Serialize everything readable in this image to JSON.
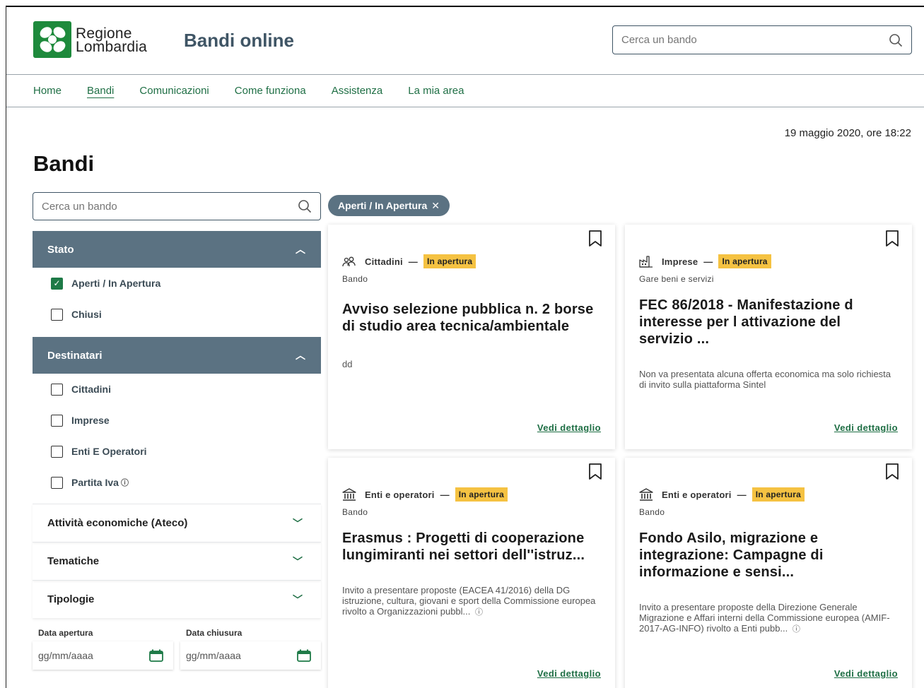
{
  "header": {
    "brand_line1": "Regione",
    "brand_line2": "Lombardia",
    "site_title": "Bandi online",
    "search_placeholder": "Cerca un bando"
  },
  "nav": [
    "Home",
    "Bandi",
    "Comunicazioni",
    "Come funziona",
    "Assistenza",
    "La mia area"
  ],
  "nav_active": "Bandi",
  "timestamp": "19 maggio 2020, ore 18:22",
  "page_title": "Bandi",
  "sidebar": {
    "search_placeholder": "Cerca un bando",
    "stato": {
      "title": "Stato",
      "options": [
        {
          "label": "Aperti / In Apertura",
          "checked": true
        },
        {
          "label": "Chiusi",
          "checked": false
        }
      ]
    },
    "destinatari": {
      "title": "Destinatari",
      "options": [
        {
          "label": "Cittadini",
          "checked": false
        },
        {
          "label": "Imprese",
          "checked": false
        },
        {
          "label": "Enti E Operatori",
          "checked": false
        },
        {
          "label": "Partita Iva",
          "checked": false
        }
      ]
    },
    "collapsed": [
      "Attività economiche (Ateco)",
      "Tematiche",
      "Tipologie"
    ],
    "date_open_label": "Data apertura",
    "date_close_label": "Data chiusura",
    "date_placeholder": "gg/mm/aaaa"
  },
  "active_filter_chip": "Aperti / In Apertura",
  "cards": [
    {
      "target": "Cittadini",
      "icon": "people-icon",
      "status": "In apertura",
      "kind": "Bando",
      "title": "Avviso selezione pubblica n. 2 borse di studio area tecnica/ambientale",
      "description": "dd",
      "link": "Vedi dettaglio"
    },
    {
      "target": "Imprese",
      "icon": "factory-icon",
      "status": "In apertura",
      "kind": "Gare beni e servizi",
      "title": "FEC 86/2018 - Manifestazione d interesse per l attivazione del servizio ...",
      "description": "Non va presentata alcuna offerta economica ma solo richiesta di invito sulla piattaforma Sintel",
      "link": "Vedi dettaglio"
    },
    {
      "target": "Enti e operatori",
      "icon": "institution-icon",
      "status": "In apertura",
      "kind": "Bando",
      "title": "Erasmus : Progetti di cooperazione lungimiranti nei settori dell''istruz...",
      "description": "Invito a presentare proposte (EACEA 41/2016) della DG istruzione, cultura, giovani e sport della Commissione europea rivolto a Organizzazioni pubbl...",
      "link": "Vedi dettaglio"
    },
    {
      "target": "Enti e operatori",
      "icon": "institution-icon",
      "status": "In apertura",
      "kind": "Bando",
      "title": "Fondo Asilo, migrazione e integrazione: Campagne di informazione e sensi...",
      "description": "Invito a presentare proposte della Direzione Generale Migrazione e Affari interni della Commissione europea (AMIF-2017-AG-INFO) rivolto a Enti pubb...",
      "link": "Vedi dettaglio"
    }
  ]
}
